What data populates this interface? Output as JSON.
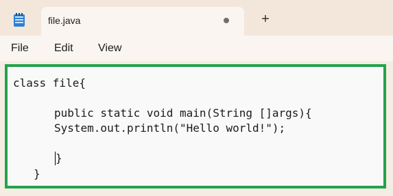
{
  "tab": {
    "title": "file.java",
    "new_tab_symbol": "+"
  },
  "menu": {
    "items": [
      "File",
      "Edit",
      "View"
    ]
  },
  "editor": {
    "lines": [
      "class file{",
      "",
      "public static void main(String []args){",
      "System.out.println(\"Hello world!\");",
      "",
      "}",
      "}"
    ]
  },
  "colors": {
    "accent_border": "#22a34a",
    "titlebar": "#f3e6da",
    "tab": "#faf5f0"
  },
  "icons": {
    "app": "notepad-icon",
    "unsaved": "unsaved-dot-icon",
    "add": "plus-icon"
  }
}
